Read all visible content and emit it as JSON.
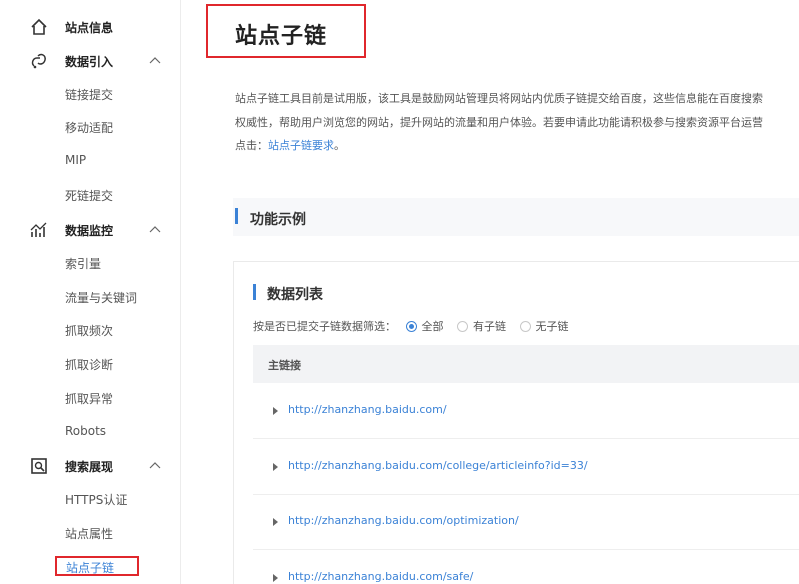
{
  "sidebar": {
    "groups": [
      {
        "label": "站点信息",
        "icon": "home-icon"
      },
      {
        "label": "数据引入",
        "icon": "data-import-icon",
        "items": [
          "链接提交",
          "移动适配",
          "MIP",
          "死链提交"
        ]
      },
      {
        "label": "数据监控",
        "icon": "monitor-chart-icon",
        "items": [
          "索引量",
          "流量与关键词",
          "抓取频次",
          "抓取诊断",
          "抓取异常",
          "Robots"
        ]
      },
      {
        "label": "搜索展现",
        "icon": "search-display-icon",
        "items": [
          "HTTPS认证",
          "站点属性",
          "站点子链"
        ]
      }
    ]
  },
  "main": {
    "title": "站点子链",
    "description": [
      "站点子链工具目前是试用版，该工具是鼓励网站管理员将网站内优质子链提交给百度，这些信息能在百度搜索",
      "权威性，帮助用户浏览您的网站，提升网站的流量和用户体验。若要申请此功能请积极参与搜索资源平台运营",
      "点击："
    ],
    "description_link": "站点子链要求",
    "description_end": "。",
    "section_title": "功能示例",
    "panel": {
      "title": "数据列表",
      "filter_label": "按是否已提交子链数据筛选：",
      "filter_options": [
        {
          "label": "全部",
          "checked": true
        },
        {
          "label": "有子链",
          "checked": false
        },
        {
          "label": "无子链",
          "checked": false
        }
      ],
      "table_header": "主链接",
      "rows": [
        "http://zhanzhang.baidu.com/",
        "http://zhanzhang.baidu.com/college/articleinfo?id=33/",
        "http://zhanzhang.baidu.com/optimization/",
        "http://zhanzhang.baidu.com/safe/"
      ]
    }
  },
  "colors": {
    "accent": "#3b82d6",
    "highlight": "#e0272c"
  }
}
